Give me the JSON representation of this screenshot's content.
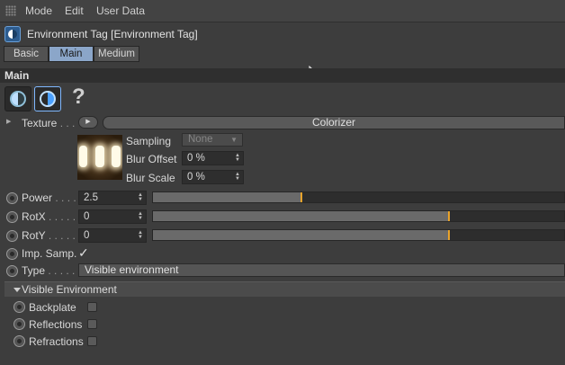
{
  "menubar": {
    "items": [
      "Mode",
      "Edit",
      "User Data"
    ]
  },
  "header": {
    "title": "Environment Tag [Environment Tag]"
  },
  "tabs": [
    {
      "label": "Basic",
      "active": false
    },
    {
      "label": "Main",
      "active": true
    },
    {
      "label": "Medium",
      "active": false
    }
  ],
  "section": {
    "title": "Main"
  },
  "help_symbol": "?",
  "texture": {
    "label": "Texture",
    "dots": ". . .",
    "arrow_icon": "play-icon",
    "shader": "Colorizer",
    "sampling": {
      "label": "Sampling",
      "value": "None"
    },
    "blur_offset": {
      "label": "Blur Offset",
      "value": "0 %"
    },
    "blur_scale": {
      "label": "Blur Scale",
      "value": "0 %"
    }
  },
  "params": {
    "power": {
      "label": "Power",
      "dots": ". . . .",
      "value": "2.5",
      "slider_fraction": 0.36
    },
    "rotx": {
      "label": "RotX",
      "dots": ". . . . .",
      "value": "0",
      "slider_fraction": 0.72
    },
    "roty": {
      "label": "RotY",
      "dots": ". . . . .",
      "value": "0",
      "slider_fraction": 0.72
    },
    "imp_samp": {
      "label": "Imp. Samp.",
      "checked": true,
      "check_glyph": "✓"
    },
    "type": {
      "label": "Type",
      "dots": ". . . . .",
      "value": "Visible environment"
    }
  },
  "visible_environment": {
    "title": "Visible Environment",
    "items": [
      {
        "label": "Backplate",
        "checked": false
      },
      {
        "label": "Reflections",
        "checked": false
      },
      {
        "label": "Refractions",
        "checked": false
      }
    ]
  },
  "colors": {
    "accent": "#8ba6c9",
    "knob": "#e8a32b",
    "background": "#3d3d3d"
  }
}
